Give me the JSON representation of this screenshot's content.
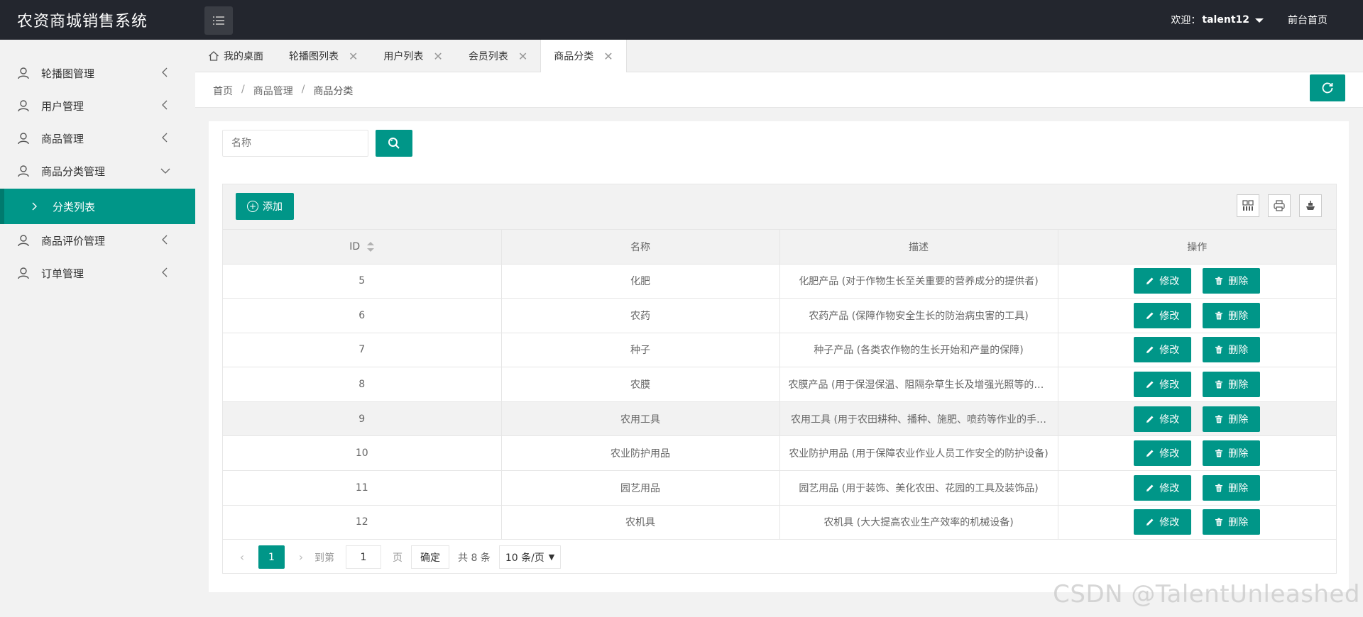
{
  "app": {
    "title": "农资商城销售系统"
  },
  "header": {
    "welcome_label": "欢迎：",
    "username": "talent12",
    "home_link": "前台首页"
  },
  "sidebar": {
    "items": [
      {
        "label": "轮播图管理"
      },
      {
        "label": "用户管理"
      },
      {
        "label": "商品管理"
      },
      {
        "label": "商品分类管理",
        "expanded": true
      },
      {
        "label": "商品评价管理"
      },
      {
        "label": "订单管理"
      }
    ],
    "active_sub": {
      "label": "分类列表"
    }
  },
  "tabs": [
    {
      "label": "我的桌面",
      "closable": false
    },
    {
      "label": "轮播图列表",
      "closable": true
    },
    {
      "label": "用户列表",
      "closable": true
    },
    {
      "label": "会员列表",
      "closable": true
    },
    {
      "label": "商品分类",
      "closable": true,
      "active": true
    }
  ],
  "breadcrumb": {
    "home": "首页",
    "level2": "商品管理",
    "current": "商品分类",
    "separator": "/"
  },
  "search": {
    "placeholder": "名称"
  },
  "toolbar": {
    "add_label": "添加"
  },
  "table": {
    "columns": [
      "ID",
      "名称",
      "描述",
      "操作"
    ],
    "edit_label": "修改",
    "delete_label": "删除",
    "rows": [
      {
        "id": "5",
        "name": "化肥",
        "desc": "化肥产品 (对于作物生长至关重要的营养成分的提供者)"
      },
      {
        "id": "6",
        "name": "农药",
        "desc": "农药产品 (保障作物安全生长的防治病虫害的工具)"
      },
      {
        "id": "7",
        "name": "种子",
        "desc": "种子产品 (各类农作物的生长开始和产量的保障)"
      },
      {
        "id": "8",
        "name": "农膜",
        "desc": "农膜产品 (用于保湿保温、阻隔杂草生长及增强光照等的农…"
      },
      {
        "id": "9",
        "name": "农用工具",
        "desc": "农用工具  (用于农田耕种、播种、施肥、喷药等作业的手…",
        "highlighted": true
      },
      {
        "id": "10",
        "name": "农业防护用品",
        "desc": "农业防护用品 (用于保障农业作业人员工作安全的防护设备)"
      },
      {
        "id": "11",
        "name": "园艺用品",
        "desc": "园艺用品 (用于装饰、美化农田、花园的工具及装饰品)"
      },
      {
        "id": "12",
        "name": "农机具",
        "desc": "农机具 (大大提高农业生产效率的机械设备)"
      }
    ]
  },
  "pager": {
    "current_page": "1",
    "goto_label": "到第",
    "goto_value": "1",
    "page_label": "页",
    "confirm_label": "确定",
    "total_label": "共 8 条",
    "page_size": "10 条/页"
  },
  "watermark": "CSDN @TalentUnleashed",
  "colors": {
    "accent": "#009688",
    "header_bg": "#23262e"
  }
}
